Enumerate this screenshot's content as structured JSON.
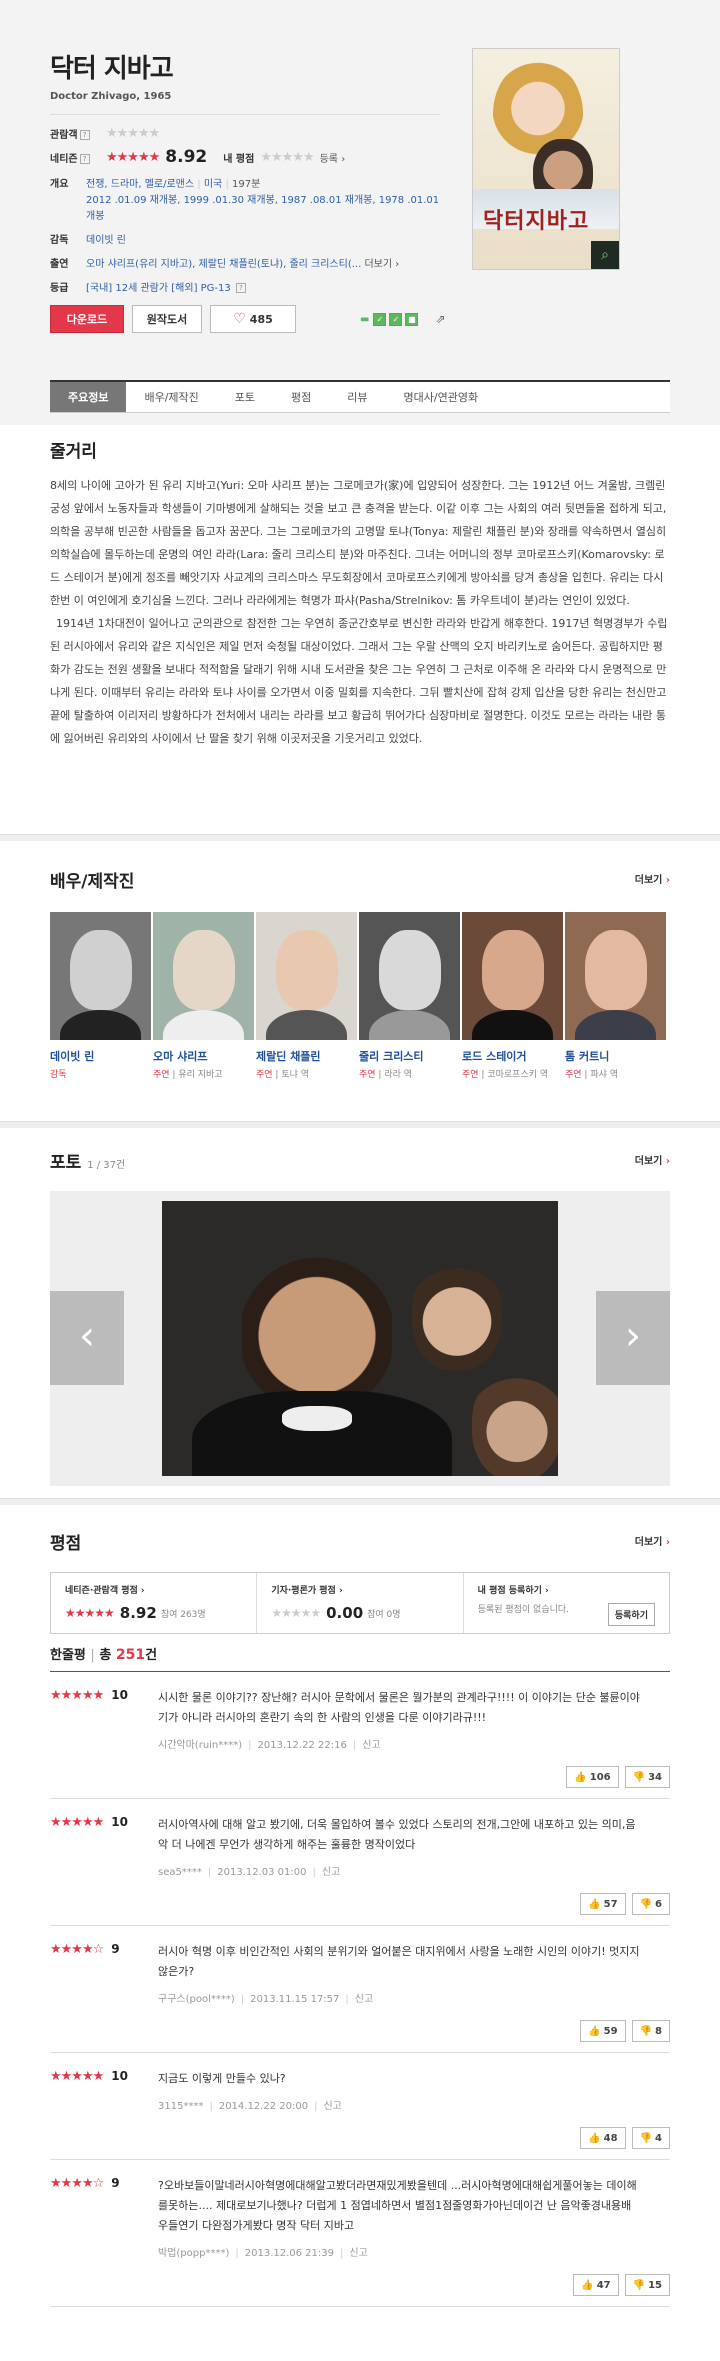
{
  "movie": {
    "title": "닥터 지바고",
    "subtitle": "Doctor Zhivago, 1965",
    "audience_label": "관람객",
    "netizen_label": "네티즌",
    "netizen_score": "8.92",
    "my_rating_label": "내 평점",
    "register_label": "등록",
    "poster_title": "닥터지바고",
    "info": {
      "overview_label": "개요",
      "genres": "전쟁, 드라마, 멜로/로맨스",
      "country": "미국",
      "runtime": "197분",
      "release": "2012 .01.09 재개봉, 1999 .01.30 재개봉, 1987 .08.01 재개봉, 1978 .01.01 개봉",
      "director_label": "감독",
      "director": "데이빗 린",
      "cast_label": "출연",
      "cast": "오마 샤리프(유리 지바고), 제랄딘 채플린(토냐), 줄리 크리스티(...",
      "cast_more": "더보기",
      "grade_label": "등급",
      "grade": "[국내] 12세 관람가 [해외] PG-13"
    },
    "buttons": {
      "download": "다운로드",
      "original": "원작도서",
      "like_count": "485"
    }
  },
  "tabs": [
    "주요정보",
    "배우/제작진",
    "포토",
    "평점",
    "리뷰",
    "명대사/연관영화"
  ],
  "story": {
    "title": "줄거리",
    "p1": "8세의 나이에 고아가 된 유리 지바고(Yuri: 오마 샤리프 분)는 그로메코가(家)에 입양되어 성장한다. 그는 1912년 어느 겨울밤, 크렘린 궁성 앞에서 노동자들과 학생들이 기마병에게 살해되는 것을 보고 큰 충격을 받는다. 이같 이후 그는 사회의 여러 뒷면들을 접하게 되고, 의학을 공부해 빈곤한 사람들을 돕고자 꿈꾼다. 그는 그로메코가의 고명딸 토냐(Tonya: 제랄린 채플린 분)와 장래를 약속하면서 열심히 의학실습에 몰두하는데 운명의 여인 라라(Lara: 줄리 크리스티 분)와 마주친다. 그녀는 어머니의 정부 코마로프스키(Komarovsky: 로드 스테이거 분)에게 정조를 빼앗기자 사교계의 크리스마스 무도회장에서 코마로프스키에게 방아쇠를 당겨 총상을 입힌다. 유리는 다시 한번 이 여인에게 호기심을 느낀다. 그러나 라라에게는 혁명가 파샤(Pasha/Strelnikov: 톰 카우트네이 분)라는 연인이 있었다.",
    "p2": "1914년 1차대전이 일어나고 군의관으로 참전한 그는 우연히 종군간호부로 변신한 라라와 반갑게 해후한다. 1917년 혁명경부가 수립된 러시아에서 유리와 같은 지식인은 제일 먼저 숙청될 대상이었다. 그래서 그는 우랄 산맥의 오지 바리키노로 숨어든다. 공립하지만 평화가 감도는 전원 생활을 보내다 적적함을 달래기 위해 시내 도서관을 찾은 그는 우연히 그 근처로 이주해 온 라라와 다시 운명적으로 만나게 된다. 이때부터 유리는 라라와 토냐 사이를 오가면서 이중 밀회를 지속한다. 그뒤 빨치산에 잡혀 강제 입산을 당한 유리는 천신만고 끝에 탈출하여 이리저리 방황하다가 전처에서 내리는 라라를 보고 황급히 뛰어가다 심장마비로 절명한다. 이것도 모르는 라라는 내란 통에 잃어버린 유리와의 사이에서 난 딸을 찾기 위해 이곳저곳을 기웃거리고 있었다."
  },
  "cast_section": {
    "title": "배우/제작진",
    "more": "더보기",
    "people": [
      {
        "name": "데이빗 린",
        "role": "감독",
        "character": ""
      },
      {
        "name": "오마 샤리프",
        "role": "주연",
        "character": "유리 지바고"
      },
      {
        "name": "제랄딘 채플린",
        "role": "주연",
        "character": "토냐 역"
      },
      {
        "name": "줄리 크리스티",
        "role": "주연",
        "character": "라라 역"
      },
      {
        "name": "로드 스테이거",
        "role": "주연",
        "character": "코마로프스키 역"
      },
      {
        "name": "톰 커트니",
        "role": "주연",
        "character": "파샤 역"
      }
    ]
  },
  "photo_section": {
    "title": "포토",
    "count": "1 / 37건",
    "more": "더보기"
  },
  "ratings": {
    "title": "평점",
    "more": "더보기",
    "netizen_label": "네티즌·관람객 평점",
    "netizen_score": "8.92",
    "netizen_participants": "참여 263명",
    "critic_label": "기자·평론가 평점",
    "critic_score": "0.00",
    "critic_participants": "참여 0명",
    "my_label": "내 평점 등록하기",
    "my_text": "등록된 평점이 없습니다.",
    "my_button": "등록하기",
    "oneliner_label": "한줄평",
    "oneliner_total": "총",
    "oneliner_count": "251",
    "oneliner_unit": "건"
  },
  "reviews": [
    {
      "stars": "★★★★★",
      "score": "10",
      "text": "시시한 물론 이야기?? 장난해? 러시아 문학에서 물론은 뭘가분의 관계라구!!!! 이 이야기는 단순 불륜이야기가 아니라 러시아의 혼란기 속의 한 사람의 인생을 다룬 이야기라규!!!",
      "user": "시간악마(ruin****)",
      "date": "2013.12.22 22:16",
      "report": "신고",
      "up": "106",
      "down": "34"
    },
    {
      "stars": "★★★★★",
      "score": "10",
      "text": "러시아역사에 대해 알고 봤기에, 더욱 몰입하여 볼수 있었다 스토리의 전개,그안에 내포하고 있는 의미,음악 더 나에겐 무언가 생각하게 해주는 훌륭한 명작이었다",
      "user": "sea5****",
      "date": "2013.12.03 01:00",
      "report": "신고",
      "up": "57",
      "down": "6"
    },
    {
      "stars": "★★★★☆",
      "score": "9",
      "text": "러시아 혁명 이후 비인간적인 사회의 분위기와 얼어붙은 대지위에서 사랑을 노래한 시인의 이야기! 멋지지 않은가?",
      "user": "구구스(pool****)",
      "date": "2013.11.15 17:57",
      "report": "신고",
      "up": "59",
      "down": "8"
    },
    {
      "stars": "★★★★★",
      "score": "10",
      "text": "지금도 이렇게 만들수 있나?",
      "user": "3115****",
      "date": "2014.12.22 20:00",
      "report": "신고",
      "up": "48",
      "down": "4"
    },
    {
      "stars": "★★★★☆",
      "score": "9",
      "text": "?오바보들이말네러시아혁명에대해알고봤더라면재밌게봤을텐데 ...러시아혁명에대해쉽게풀어놓는 데이해를못하는.... 제대로보기나했나? 더럽게 1 점엽네하면서 별점1점줄영화가아닌데이건 난 음악좋경내용배우들연기 다완점가게봤다 명작 닥터 지바고",
      "user": "박멉(popp****)",
      "date": "2013.12.06 21:39",
      "report": "신고",
      "up": "47",
      "down": "15"
    }
  ]
}
